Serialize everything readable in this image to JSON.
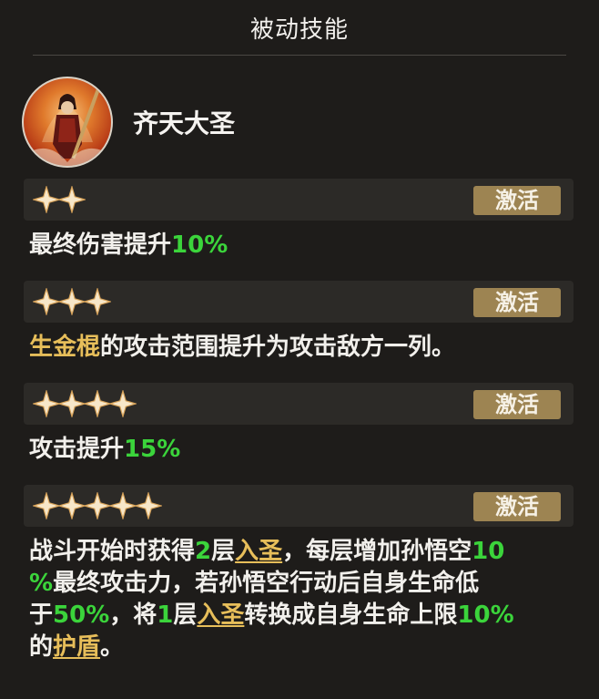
{
  "header": {
    "title": "被动技能"
  },
  "skill": {
    "name": "齐天大圣"
  },
  "tiers": [
    {
      "stars": 2,
      "button": "激活",
      "desc": {
        "t1": "最终伤害提升",
        "t2": "10%"
      }
    },
    {
      "stars": 3,
      "button": "激活",
      "desc": {
        "t1": "生金棍",
        "t2": "的攻击范围提升为攻击敌方一列。"
      }
    },
    {
      "stars": 4,
      "button": "激活",
      "desc": {
        "t1": "攻击提升",
        "t2": "15%"
      }
    },
    {
      "stars": 5,
      "button": "激活",
      "desc": {
        "l1a": "战斗开始时获得",
        "l1b": "2",
        "l1c": "层",
        "l1d": "入圣",
        "l1e": "，每层增加孙悟空",
        "l1f": "10",
        "l2a": "%",
        "l2b": "最终攻击力，若孙悟空行动后自身生命低",
        "l3a": "于",
        "l3b": "50%",
        "l3c": "，将",
        "l3d": "1",
        "l3e": "层",
        "l3f": "入圣",
        "l3g": "转换成自身生命上限",
        "l3h": "10%",
        "l4a": "的",
        "l4b": "护盾",
        "l4c": "。"
      }
    }
  ],
  "colors": {
    "highlight_green": "#3bd43b",
    "highlight_gold": "#e7be5a",
    "button_bg": "#9d8452"
  }
}
